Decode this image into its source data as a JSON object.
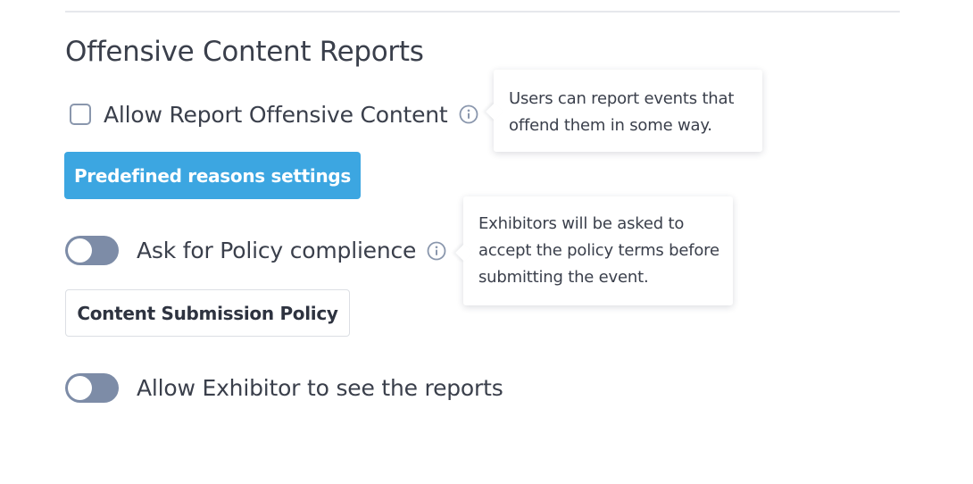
{
  "section": {
    "title": "Offensive Content Reports"
  },
  "report_offensive": {
    "label": "Allow Report Offensive Content",
    "checked": false,
    "tooltip": "Users can report events that\noffend them in some way."
  },
  "predefined_button": {
    "label": "Predefined reasons settings"
  },
  "policy_compliance": {
    "label": "Ask for Policy complience",
    "enabled": false,
    "tooltip": "Exhibitors will be asked to\naccept the policy terms before\nsubmitting the event."
  },
  "policy_button": {
    "label": "Content Submission Policy"
  },
  "exhibitor_reports": {
    "label": "Allow Exhibitor to see the reports",
    "enabled": false
  },
  "colors": {
    "primary_button": "#3ca6e1",
    "toggle_off": "#7d8ca7",
    "checkbox_border": "#8a97ad",
    "text": "#3a3f4b",
    "divider": "#e6e8ec"
  },
  "icons": {
    "info": "info-circle-icon"
  }
}
